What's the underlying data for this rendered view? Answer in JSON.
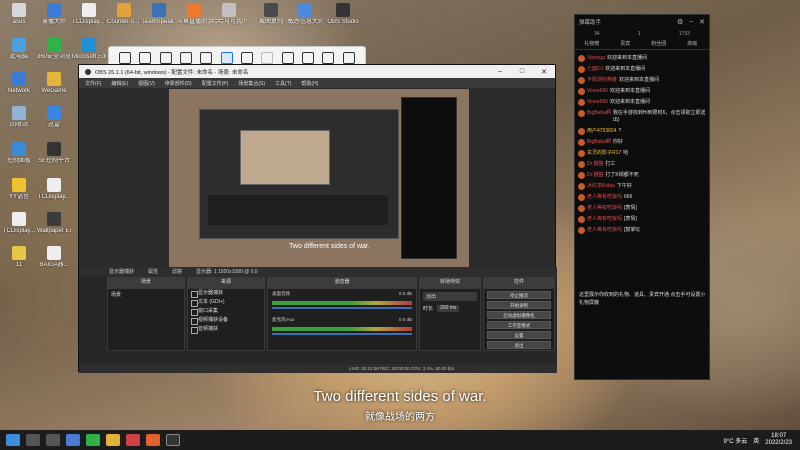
{
  "desktop": {
    "icons": [
      {
        "label": "asus",
        "color": "#d7d7d7"
      },
      {
        "label": "录播大师",
        "color": "#3b7bd4"
      },
      {
        "label": "TCDisplay... (1)",
        "color": "#eeeeee"
      },
      {
        "label": "Counter-S... Global Off...",
        "color": "#e3a13a"
      },
      {
        "label": "TeamSpeak 3",
        "color": "#3973b5"
      },
      {
        "label": "斗鱼直播助手",
        "color": "#f07830"
      },
      {
        "label": "哈哈可可我的",
        "color": "#c0c0c0"
      },
      {
        "label": "截图复制",
        "color": "#4a4a4a"
      },
      {
        "label": "敏感信息大师",
        "color": "#4a89dc"
      },
      {
        "label": "OBS Studio",
        "color": "#333333"
      },
      {
        "label": "此电脑",
        "color": "#4aa0e0"
      },
      {
        "label": "360安全浏览器",
        "color": "#2db34a"
      },
      {
        "label": "Microsoft Edge",
        "color": "#1f8fd6"
      },
      {
        "label": "Network",
        "color": "#3b7bd4"
      },
      {
        "label": "WeGame",
        "color": "#e6b43a"
      },
      {
        "label": "回收站",
        "color": "#8fb4d8"
      },
      {
        "label": "迅雷",
        "color": "#3a86e0"
      },
      {
        "label": "控制面板",
        "color": "#3b8ad8"
      },
      {
        "label": "SE控制平台",
        "color": "#333333"
      },
      {
        "label": "YY语音",
        "color": "#f2c12e"
      },
      {
        "label": "TCDisplay...",
        "color": "#eeeeee"
      },
      {
        "label": "TCDisplay...",
        "color": "#eeeeee"
      },
      {
        "label": "Wallpaper Engine:...",
        "color": "#3b3b3b"
      },
      {
        "label": "11",
        "color": "#e8c64a"
      },
      {
        "label": "BAIGA器...",
        "color": "#eeeeee"
      }
    ]
  },
  "snip_toolbar": {
    "tools": [
      "scroll-icon",
      "screen-icon",
      "expand-icon",
      "camera-icon",
      "record-icon",
      "region-icon",
      "pen-icon",
      "undo-icon",
      "save-icon",
      "share-icon",
      "gear-icon",
      "more-icon"
    ]
  },
  "obs": {
    "title": "OBS 26.1.1 (64-bit, windows) - 配置文件: 未命名 - 场景: 未命名",
    "menu": [
      "文件(F)",
      "编辑(E)",
      "视图(V)",
      "停靠部件(D)",
      "配置文件(P)",
      "场景集合(S)",
      "工具(T)",
      "帮助(H)"
    ],
    "win_controls": [
      "–",
      "□",
      "✕"
    ],
    "docks": {
      "scenes": {
        "title": "场景",
        "items": [
          "场景"
        ]
      },
      "sources": {
        "title": "来源",
        "items": [
          "显示器捕获",
          "文本 (GDI+)",
          "窗口采集",
          "视频捕获设备",
          "音频捕获"
        ]
      },
      "mixer": {
        "title": "混音器",
        "tracks": [
          {
            "name": "桌面音频",
            "db": "0.0 dB"
          },
          {
            "name": "麦克风/Aux",
            "db": "0.0 dB"
          }
        ]
      },
      "transitions": {
        "title": "转场特效",
        "mode": "淡出",
        "duration_label": "时长",
        "duration": "300 ms"
      },
      "controls": {
        "title": "控件",
        "buttons": [
          "停止推流",
          "开始录制",
          "启动虚拟摄像机",
          "工作室模式",
          "设置",
          "退出"
        ]
      },
      "display_label": "显示器捕获",
      "props_label": "属性",
      "filters_label": "滤镜",
      "display_select": "显示器: 1 1920x1080 @ 0,0"
    },
    "status": "LIVE: 00:12:08   REC: 00:00:00   CPU: 3.4%, 60.00 fps"
  },
  "chat": {
    "title": "弹幕助手",
    "stats": [
      "34",
      "1",
      "1793"
    ],
    "tabs": [
      "礼物榜",
      "贵宾",
      "粉丝团",
      "高级"
    ],
    "messages": [
      {
        "name": "Vipsoup",
        "text": "欢迎来到本直播间",
        "style": "badge"
      },
      {
        "name": "七面DJ",
        "text": "欢迎来到本直播间",
        "style": "badge"
      },
      {
        "name": "不羁游的英雄",
        "text": "欢迎来到本直播间",
        "style": "badge"
      },
      {
        "name": "Vinee666",
        "text": "欢迎来到本直播间",
        "style": "badge"
      },
      {
        "name": "Vinee666",
        "text": "欢迎来到本直播间",
        "style": "badge"
      },
      {
        "name": "BigBaba啊",
        "text": "我在手游找到Hi到限时6，点击领取立即送出)",
        "style": "badge"
      },
      {
        "name": "用户4793824",
        "text": "?",
        "style": "plain"
      },
      {
        "name": "BigBaba啊",
        "text": "你好",
        "style": "badge"
      },
      {
        "name": "玄灵的影子R17",
        "text": "哈",
        "style": "plain"
      },
      {
        "name": "Dr.猫猫",
        "text": "打工",
        "style": "badge"
      },
      {
        "name": "Dr.猫猫",
        "text": "打了K锅都不死",
        "style": "badge"
      },
      {
        "name": "冰红茶Kidaa",
        "text": "下午好",
        "style": "badge"
      },
      {
        "name": "老人等有吃饭吗",
        "text": "666",
        "style": "badge"
      },
      {
        "name": "老人等有吃饭吗",
        "text": "[表情]",
        "style": "badge"
      },
      {
        "name": "老人等有吃饭吗",
        "text": "[表情]",
        "style": "badge"
      },
      {
        "name": "老人等有吃饭吗",
        "text": "[鼓掌5]",
        "style": "badge"
      }
    ],
    "notice": "这里展示你收到的礼物、道具、贵宾开通 点击手可设置小礼物屏蔽",
    "controls": [
      "⚙",
      "–",
      "✕"
    ]
  },
  "subtitles": {
    "en": "Two different sides of war.",
    "zh": "就像战场的两方"
  },
  "taskbar": {
    "weather": "9°C 多云",
    "time": "18:07",
    "date": "2022/2/23",
    "lang": "英",
    "pinned": [
      "start-icon",
      "search-icon",
      "task-view-icon",
      "widgets-icon",
      "wechat-icon",
      "folder-icon",
      "game-icon",
      "browser-icon",
      "obs-icon"
    ]
  }
}
